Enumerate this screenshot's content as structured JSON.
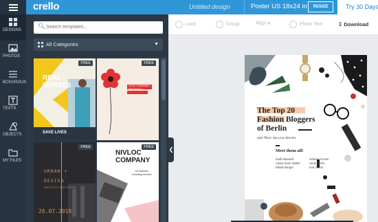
{
  "app": {
    "logo": "crello",
    "document_title": "Untitled design",
    "size_label": "Poster US 18x24 in",
    "resize_label": "RESIZE",
    "trial_label": "Try 30 Days Pr"
  },
  "nav": {
    "items": [
      {
        "label": "DESIGNS",
        "icon": "designs-icon"
      },
      {
        "label": "PHOTOS",
        "icon": "photos-icon"
      },
      {
        "label": "BCKGROUND",
        "icon": "background-icon"
      },
      {
        "label": "TEXTS",
        "icon": "texts-icon"
      },
      {
        "label": "OBJECTS",
        "icon": "objects-icon"
      },
      {
        "label": "MY FILES",
        "icon": "my-files-icon"
      }
    ]
  },
  "panel": {
    "search_placeholder": "Search templates...",
    "category": "All Categories",
    "templates": [
      {
        "badge": "FREE",
        "line1": "REAL",
        "line2": "NURSES",
        "footer": "SAVE LIVES"
      },
      {
        "badge": "FREE",
        "text": "LOVE YOURSELF INSTANTLY"
      },
      {
        "badge": "FREE",
        "line1": "URBAN +",
        "line2": "DESIGN",
        "sub": "ARCHITECTURE FORUM",
        "date": "26.07.2018"
      },
      {
        "badge": "FREE",
        "line1": "NIVLOC",
        "line2": "COMPANY",
        "desc": "Our Business Consulting Services"
      }
    ]
  },
  "toolbar": {
    "lock": "Lock",
    "group": "Group",
    "align": "Align",
    "photo_text": "Photo Text",
    "download": "Download"
  },
  "canvas": {
    "title_lines": [
      "The Top 20",
      "Fashion Bloggers",
      "of Berlin"
    ],
    "subtitle": "and Their Success Stories",
    "meet": "Meet them all!",
    "names_left": [
      "Gabi Maxwell",
      "Adam Nose Walter",
      "Elhide Berger"
    ],
    "names_right": [
      "Odessa Komer",
      "Hedy Bohm",
      "and others"
    ]
  }
}
